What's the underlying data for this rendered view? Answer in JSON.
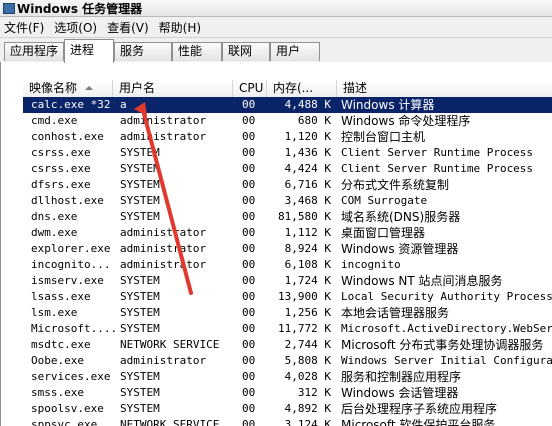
{
  "window": {
    "title": "Windows 任务管理器"
  },
  "menu": [
    "文件(F)",
    "选项(O)",
    "查看(V)",
    "帮助(H)"
  ],
  "tabs": [
    {
      "label": "应用程序"
    },
    {
      "label": "进程"
    },
    {
      "label": "服务"
    },
    {
      "label": "性能"
    },
    {
      "label": "联网"
    },
    {
      "label": "用户"
    }
  ],
  "columns": {
    "name": "映像名称",
    "user": "用户名",
    "cpu": "CPU",
    "mem": "内存(...",
    "desc": "描述"
  },
  "rows": [
    {
      "name": "calc.exe *32",
      "user": "a",
      "cpu": "00",
      "mem": "4,488 K",
      "desc": "Windows 计算器",
      "selected": true
    },
    {
      "name": "cmd.exe",
      "user": "administrator",
      "cpu": "00",
      "mem": "680 K",
      "desc": "Windows 命令处理程序"
    },
    {
      "name": "conhost.exe",
      "user": "administrator",
      "cpu": "00",
      "mem": "1,120 K",
      "desc": "控制台窗口主机"
    },
    {
      "name": "csrss.exe",
      "user": "SYSTEM",
      "cpu": "00",
      "mem": "1,436 K",
      "desc": "Client Server Runtime Process"
    },
    {
      "name": "csrss.exe",
      "user": "SYSTEM",
      "cpu": "00",
      "mem": "4,424 K",
      "desc": "Client Server Runtime Process"
    },
    {
      "name": "dfsrs.exe",
      "user": "SYSTEM",
      "cpu": "00",
      "mem": "6,716 K",
      "desc": "分布式文件系统复制"
    },
    {
      "name": "dllhost.exe",
      "user": "SYSTEM",
      "cpu": "00",
      "mem": "3,468 K",
      "desc": "COM Surrogate"
    },
    {
      "name": "dns.exe",
      "user": "SYSTEM",
      "cpu": "00",
      "mem": "81,580 K",
      "desc": "域名系统(DNS)服务器"
    },
    {
      "name": "dwm.exe",
      "user": "administrator",
      "cpu": "00",
      "mem": "1,112 K",
      "desc": "桌面窗口管理器"
    },
    {
      "name": "explorer.exe",
      "user": "administrator",
      "cpu": "00",
      "mem": "8,924 K",
      "desc": "Windows 资源管理器"
    },
    {
      "name": "incognito...",
      "user": "administrator",
      "cpu": "00",
      "mem": "6,108 K",
      "desc": "incognito"
    },
    {
      "name": "ismserv.exe",
      "user": "SYSTEM",
      "cpu": "00",
      "mem": "1,724 K",
      "desc": "Windows NT 站点间消息服务"
    },
    {
      "name": "lsass.exe",
      "user": "SYSTEM",
      "cpu": "00",
      "mem": "13,900 K",
      "desc": "Local Security Authority Process"
    },
    {
      "name": "lsm.exe",
      "user": "SYSTEM",
      "cpu": "00",
      "mem": "1,256 K",
      "desc": "本地会话管理器服务"
    },
    {
      "name": "Microsoft....",
      "user": "SYSTEM",
      "cpu": "00",
      "mem": "11,772 K",
      "desc": "Microsoft.ActiveDirectory.WebServic"
    },
    {
      "name": "msdtc.exe",
      "user": "NETWORK SERVICE",
      "cpu": "00",
      "mem": "2,744 K",
      "desc": "Microsoft 分布式事务处理协调器服务"
    },
    {
      "name": "Oobe.exe",
      "user": "administrator",
      "cpu": "00",
      "mem": "5,808 K",
      "desc": "Windows Server Initial Configuratio"
    },
    {
      "name": "services.exe",
      "user": "SYSTEM",
      "cpu": "00",
      "mem": "4,028 K",
      "desc": "服务和控制器应用程序"
    },
    {
      "name": "smss.exe",
      "user": "SYSTEM",
      "cpu": "00",
      "mem": "312 K",
      "desc": "Windows 会话管理器"
    },
    {
      "name": "spoolsv.exe",
      "user": "SYSTEM",
      "cpu": "00",
      "mem": "4,892 K",
      "desc": "后台处理程序子系统应用程序"
    },
    {
      "name": "sppsvc.exe",
      "user": "NETWORK SERVICE",
      "cpu": "00",
      "mem": "3,124 K",
      "desc": "Microsoft 软件保护平台服务"
    }
  ],
  "annotation": {
    "color": "#e03a2f"
  }
}
